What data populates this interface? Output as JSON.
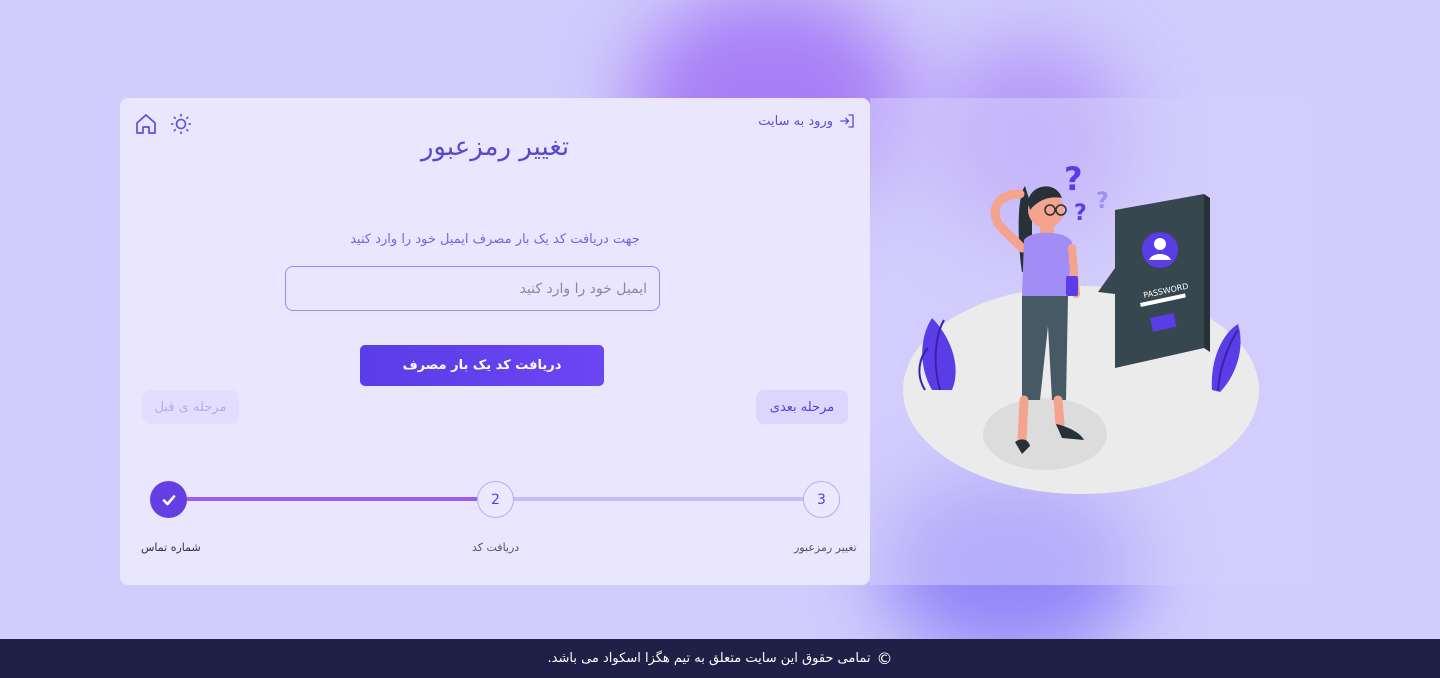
{
  "header": {
    "login_link": "ورود به سایت",
    "title": "تغییر رمزعبور"
  },
  "form": {
    "subtitle": "جهت دریافت کد یک بار مصرف ایمیل خود را وارد کنید",
    "email_placeholder": "ایمیل خود را وارد کنید",
    "email_value": "",
    "otp_button": "دریافت کد یک بار مصرف",
    "next_button": "مرحله بعدی",
    "prev_button": "مرحله ی قبل"
  },
  "stepper": {
    "steps": [
      {
        "number": "✔",
        "label": "شماره تماس",
        "state": "done"
      },
      {
        "number": "2",
        "label": "دریافت کد",
        "state": "pending"
      },
      {
        "number": "3",
        "label": "تغییر رمزعبور",
        "state": "pending"
      }
    ]
  },
  "illustration": {
    "badge_text": "PASSWORD",
    "icon": "confused-woman-password-illustration"
  },
  "footer": {
    "symbol": "©",
    "text": "تمامی حقوق این سایت متعلق به تیم هگزا اسکواد می باشد."
  },
  "icons": {
    "home": "home-icon",
    "theme": "sun-icon",
    "login": "login-arrow-icon"
  },
  "colors": {
    "accent": "#6440e4",
    "background": "#d0ccfc",
    "card": "#e9e6fd",
    "footer": "#1f1f47"
  }
}
